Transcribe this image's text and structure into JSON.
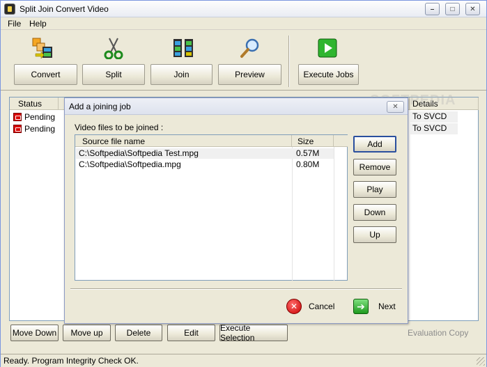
{
  "window": {
    "title": "Split Join Convert Video",
    "controls": {
      "minimize": "–",
      "maximize": "□",
      "close": "✕"
    }
  },
  "menu": {
    "items": [
      "File",
      "Help"
    ]
  },
  "toolbar": {
    "buttons": [
      {
        "label": "Convert",
        "icon": "convert-icon"
      },
      {
        "label": "Split",
        "icon": "scissors-icon"
      },
      {
        "label": "Join",
        "icon": "film-join-icon"
      },
      {
        "label": "Preview",
        "icon": "magnifier-icon"
      },
      {
        "label": "Execute Jobs",
        "icon": "play-icon"
      }
    ]
  },
  "joblist": {
    "columns": [
      "Status",
      "Details"
    ],
    "rows": [
      {
        "status": "Pending",
        "details": "To SVCD"
      },
      {
        "status": "Pending",
        "details": "To SVCD"
      }
    ]
  },
  "bottom_buttons": [
    "Move Down",
    "Move up",
    "Delete",
    "Edit",
    "Execute Selection"
  ],
  "evaluation": "Evaluation Copy",
  "statusbar": {
    "text": "Ready. Program Integrity Check OK."
  },
  "watermark": "SOFTPEDIA",
  "dialog": {
    "title": "Add a joining job",
    "close": "✕",
    "label": "Video files to be joined :",
    "columns": [
      "Source file name",
      "Size"
    ],
    "files": [
      {
        "name": "C:\\Softpedia\\Softpedia Test.mpg",
        "size": "0.57M"
      },
      {
        "name": "C:\\Softpedia\\Softpedia.mpg",
        "size": "0.80M"
      }
    ],
    "side_buttons": [
      "Add",
      "Remove",
      "Play",
      "Down",
      "Up"
    ],
    "cancel": "Cancel",
    "next": "Next",
    "colors": {
      "cancel_icon": "#c80000",
      "next_icon": "#1f9a1f"
    }
  }
}
